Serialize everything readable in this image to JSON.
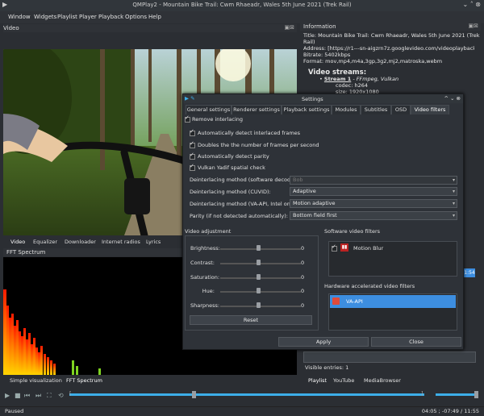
{
  "window": {
    "title": "QMPlay2 - Mountain Bike Trail: Cwm Rhaeadr, Wales 5th June 2021 (Trek Rail)"
  },
  "menu": [
    "Window",
    "Widgets",
    "Playlist",
    "Player",
    "Playback",
    "Options",
    "Help"
  ],
  "video_dock": {
    "title": "Video"
  },
  "info_dock": {
    "title": "Information",
    "title_line": "Title: Mountain Bike Trail: Cwm Rhaeadr, Wales 5th June 2021 (Trek Rail)",
    "address": "Address: [https://r1---sn-aigzrn7z.googlevideo.com/videoplayback?expire=",
    "bitrate": "Bitrate: 5402kbps",
    "format": "Format: mov,mp4,m4a,3gp,3g2,mj2,matroska,webm",
    "streams_heading": "Video streams:",
    "stream_label": "Stream 1",
    "stream_info": " - FFmpeg, Vulkan",
    "codec": "codec: h264",
    "size": "size: 1920x1080"
  },
  "bottom_tabs": [
    "Video",
    "Equalizer",
    "Downloader",
    "Internet radios",
    "Lyrics"
  ],
  "fft_dock": {
    "title": "FFT Spectrum"
  },
  "viz_tabs": [
    "Simple visualization",
    "FFT Spectrum"
  ],
  "playlist_tabs": [
    "Playlist",
    "YouTube",
    "MediaBrowser"
  ],
  "visible_entries": "Visible entries: 1",
  "side_time": "1:54",
  "status": {
    "left": "Paused",
    "right": "04:05 ; -07:49 / 11:55"
  },
  "settings": {
    "title": "Settings",
    "tabs": [
      "General settings",
      "Renderer settings",
      "Playback settings",
      "Modules",
      "Subtitles",
      "OSD",
      "Video filters"
    ],
    "active_tab": "Video filters",
    "remove_interlacing": "Remove interlacing",
    "checks": [
      "Automatically detect interlaced frames",
      "Doubles the the number of frames per second",
      "Automatically detect parity",
      "Vulkan Yadif spatial check"
    ],
    "rows": [
      {
        "label": "Deinterlacing method (software decoding):",
        "value": "Bob",
        "disabled": true
      },
      {
        "label": "Deinterlacing method (CUVID):",
        "value": "Adaptive",
        "disabled": false
      },
      {
        "label": "Deinterlacing method (VA-API, Intel only):",
        "value": "Motion adaptive",
        "disabled": false
      },
      {
        "label": "Parity (if not detected automatically):",
        "value": "Bottom field first",
        "disabled": false
      }
    ],
    "video_adjustment": {
      "title": "Video adjustment",
      "sliders": [
        {
          "label": "Brightness:",
          "value": "0"
        },
        {
          "label": "Contrast:",
          "value": "0"
        },
        {
          "label": "Saturation:",
          "value": "0"
        },
        {
          "label": "Hue:",
          "value": "0"
        },
        {
          "label": "Sharpness:",
          "value": "0"
        }
      ],
      "reset": "Reset"
    },
    "software_filters": {
      "title": "Software video filters",
      "items": [
        "Motion Blur"
      ]
    },
    "hardware_filters": {
      "title": "Hardware accelerated video filters",
      "items": [
        "VA-API"
      ]
    },
    "apply": "Apply",
    "close": "Close"
  },
  "colors": {
    "accent": "#3daee9",
    "bg": "#2b2e33",
    "selection": "#3d8ee0"
  }
}
